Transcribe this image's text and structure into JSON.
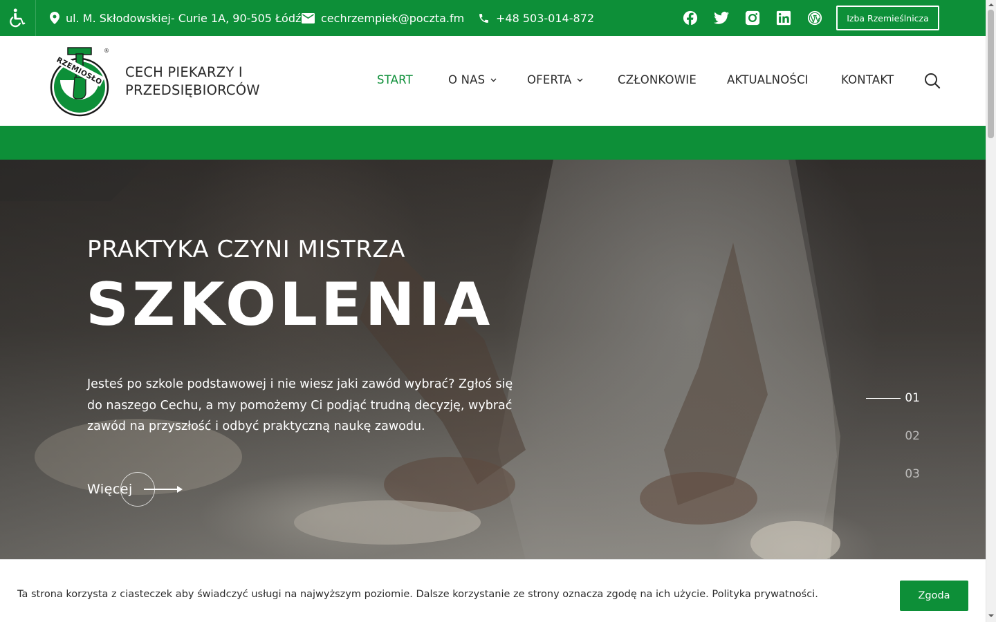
{
  "topbar": {
    "address": "ul. M. Skłodowskiej- Curie 1A, 90-505 Łódź",
    "email": "cechrzempiek@poczta.fm",
    "phone": "+48 503-014-872",
    "socials": [
      "facebook-icon",
      "twitter-icon",
      "instagram-icon",
      "linkedin-icon",
      "wordpress-icon"
    ],
    "cta_label": "Izba Rzemieślnicza"
  },
  "brand": {
    "line1": "CECH PIEKARZY I",
    "line2": "PRZEDSIĘBIORCÓW",
    "logo_text": "RZEMIOSŁO",
    "logo_mark": "®"
  },
  "nav": {
    "items": [
      {
        "label": "START",
        "active": true,
        "dropdown": false
      },
      {
        "label": "O NAS",
        "active": false,
        "dropdown": true
      },
      {
        "label": "OFERTA",
        "active": false,
        "dropdown": true
      },
      {
        "label": "CZŁONKOWIE",
        "active": false,
        "dropdown": false
      },
      {
        "label": "AKTUALNOŚCI",
        "active": false,
        "dropdown": false
      },
      {
        "label": "KONTAKT",
        "active": false,
        "dropdown": false
      }
    ]
  },
  "hero": {
    "subtitle": "PRAKTYKA CZYNI MISTRZA",
    "title": "SZKOLENIA",
    "text": "Jesteś po szkole podstawowej i nie wiesz jaki zawód wybrać? Zgłoś się do naszego Cechu, a my pomożemy Ci podjąć trudną decyzję, wybrać zawód na przyszłość i odbyć praktyczną naukę zawodu.",
    "more_label": "Więcej",
    "slides": [
      "01",
      "02",
      "03"
    ],
    "active_slide": "01"
  },
  "cookie": {
    "text": "Ta strona korzysta z ciasteczek aby świadczyć usługi na najwyższym poziomie. Dalsze korzystanie ze strony oznacza zgodę na ich użycie.",
    "link": "Polityka prywatności.",
    "accept": "Zgoda"
  },
  "colors": {
    "brand_green": "#0d8f38",
    "text_dark": "#2b2b2b",
    "white": "#ffffff"
  }
}
